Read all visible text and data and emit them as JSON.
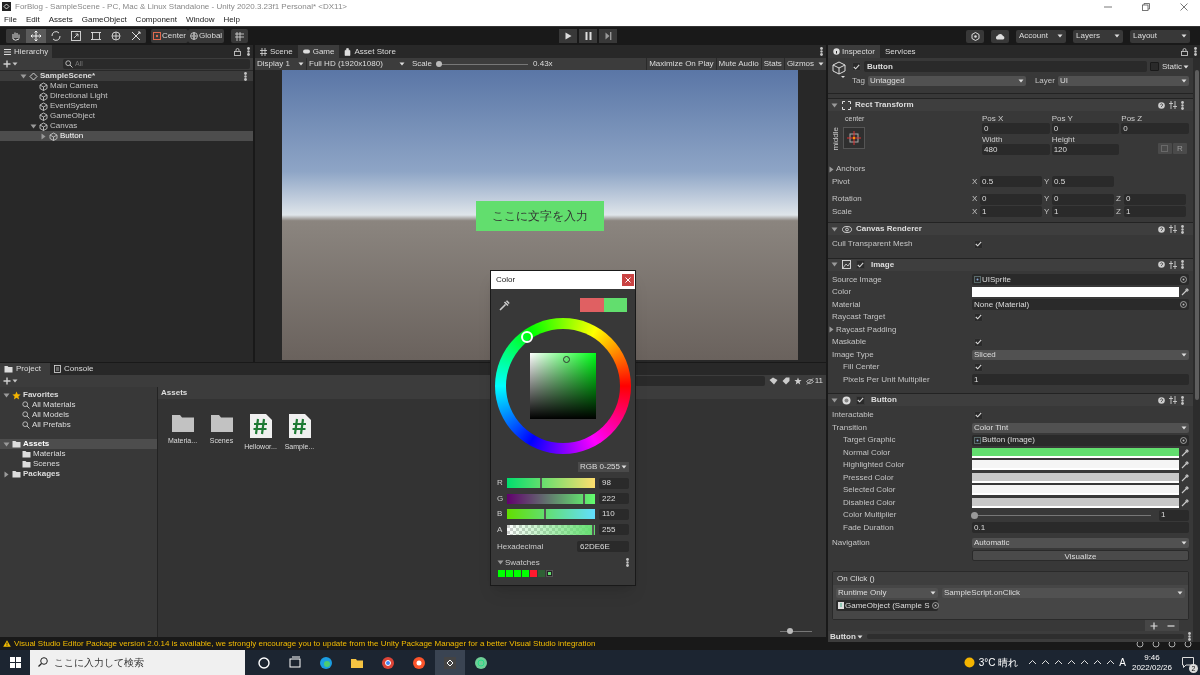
{
  "window": {
    "title": "ForBlog - SampleScene - PC, Mac & Linux Standalone - Unity 2020.3.23f1 Personal* <DX11>"
  },
  "menu": [
    "File",
    "Edit",
    "Assets",
    "GameObject",
    "Component",
    "Window",
    "Help"
  ],
  "toolbar": {
    "tools": [
      {
        "kind": "hand",
        "selected": false
      },
      {
        "kind": "move",
        "selected": true
      },
      {
        "kind": "rotate",
        "selected": false
      },
      {
        "kind": "scale",
        "selected": false
      },
      {
        "kind": "rect",
        "selected": false
      },
      {
        "kind": "transform",
        "selected": false
      },
      {
        "kind": "custom",
        "selected": false
      }
    ],
    "pivot": "Center",
    "space": "Global",
    "account": "Account",
    "layers": "Layers",
    "layout": "Layout"
  },
  "hierarchy": {
    "tab": "Hierarchy",
    "search_placeholder": "All",
    "items": [
      {
        "label": "SampleScene*",
        "kind": "scene",
        "expanded": true,
        "selected": false,
        "children": [
          {
            "label": "Main Camera",
            "kind": "object",
            "selected": false
          },
          {
            "label": "Directional Light",
            "kind": "object",
            "selected": false
          },
          {
            "label": "EventSystem",
            "kind": "object",
            "selected": false
          },
          {
            "label": "GameObject",
            "kind": "object",
            "selected": false
          },
          {
            "label": "Canvas",
            "kind": "object",
            "expanded": true,
            "selected": false,
            "children": [
              {
                "label": "Button",
                "kind": "object",
                "expanded": false,
                "selected": true
              }
            ]
          }
        ]
      }
    ]
  },
  "game": {
    "tabs": [
      {
        "label": "Scene",
        "kind": "scene",
        "selected": false
      },
      {
        "label": "Game",
        "kind": "game",
        "selected": true
      },
      {
        "label": "Asset Store",
        "kind": "store",
        "selected": false
      }
    ],
    "display": "Display 1",
    "resolution": "Full HD (1920x1080)",
    "scale_label": "Scale",
    "scale": {
      "level": 0.02
    },
    "scale_value": "0.43x",
    "buttons": [
      "Maximize On Play",
      "Mute Audio",
      "Stats",
      "Gizmos"
    ],
    "ui_button": "ここに文字を入力"
  },
  "project": {
    "tabs": [
      {
        "label": "Project",
        "kind": "folder",
        "selected": true
      },
      {
        "label": "Console",
        "kind": "console",
        "selected": false
      }
    ],
    "tree": [
      {
        "label": "Favorites",
        "kind": "favorite",
        "expanded": true,
        "selected": false,
        "children": [
          {
            "label": "All Materials",
            "kind": "search",
            "selected": false
          },
          {
            "label": "All Models",
            "kind": "search",
            "selected": false
          },
          {
            "label": "All Prefabs",
            "kind": "search",
            "selected": false
          }
        ]
      },
      {
        "label": "Assets",
        "kind": "folder",
        "expanded": true,
        "selected": true,
        "children": [
          {
            "label": "Materials",
            "kind": "folder",
            "selected": false
          },
          {
            "label": "Scenes",
            "kind": "folder",
            "selected": false
          }
        ]
      },
      {
        "label": "Packages",
        "kind": "folder",
        "expanded": false,
        "selected": false
      }
    ],
    "breadcrumb": "Assets",
    "hidden_count": "11",
    "icon_size": {
      "level": 0.3
    },
    "assets": [
      {
        "label": "Materia...",
        "kind": "folder"
      },
      {
        "label": "Scenes",
        "kind": "folder"
      },
      {
        "label": "Hellowor...",
        "kind": "script"
      },
      {
        "label": "Sample...",
        "kind": "script"
      }
    ]
  },
  "color_picker": {
    "title": "Color",
    "preview": [
      {
        "color": "#e06062"
      },
      {
        "color": "#62de6e"
      }
    ],
    "mode": "RGB 0-255",
    "channels": [
      {
        "label": "R",
        "level": 0.384,
        "value": "98"
      },
      {
        "label": "G",
        "level": 0.871,
        "value": "222"
      },
      {
        "label": "B",
        "level": 0.431,
        "value": "110"
      },
      {
        "label": "A",
        "level": 1,
        "value": "255"
      }
    ],
    "hex_label": "Hexadecimal",
    "hex": "62DE6E",
    "swatches_label": "Swatches",
    "swatches": [
      {
        "color": "#00ff00"
      },
      {
        "color": "#00ff00"
      },
      {
        "color": "#00ff00"
      },
      {
        "color": "#00ff00"
      },
      {
        "color": "#ff1a2e"
      },
      {
        "color": "#2f5f35"
      }
    ]
  },
  "inspector": {
    "tabs": [
      {
        "label": "Inspector",
        "selected": true
      },
      {
        "label": "Services",
        "selected": false
      }
    ],
    "object": {
      "active": true,
      "name": "Button",
      "static_label": "Static",
      "static": false,
      "tag_label": "Tag",
      "tag": "Untagged",
      "layer_label": "Layer",
      "layer": "UI"
    },
    "rect_transform": {
      "title": "Rect Transform",
      "anchor_h": "center",
      "anchor_v": "middle",
      "fields": [
        {
          "label": "Pos X",
          "value": "0"
        },
        {
          "label": "Pos Y",
          "value": "0"
        },
        {
          "label": "Pos Z",
          "value": "0"
        },
        {
          "label": "Width",
          "value": "480"
        },
        {
          "label": "Height",
          "value": "120"
        }
      ],
      "raw_button": "R",
      "rows": [
        {
          "label": "Anchors",
          "kind": "foldout",
          "expanded": false
        },
        {
          "label": "Pivot",
          "kind": "vector",
          "axes": [
            {
              "axis": "X",
              "value": "0.5"
            },
            {
              "axis": "Y",
              "value": "0.5"
            }
          ]
        },
        {
          "label": "Rotation",
          "kind": "vector",
          "axes": [
            {
              "axis": "X",
              "value": "0"
            },
            {
              "axis": "Y",
              "value": "0"
            },
            {
              "axis": "Z",
              "value": "0"
            }
          ]
        },
        {
          "label": "Scale",
          "kind": "vector",
          "axes": [
            {
              "axis": "X",
              "value": "1"
            },
            {
              "axis": "Y",
              "value": "1"
            },
            {
              "axis": "Z",
              "value": "1"
            }
          ]
        }
      ]
    },
    "components": [
      {
        "title": "Canvas Renderer",
        "kind": "renderer",
        "rows": [
          {
            "label": "Cull Transparent Mesh",
            "kind": "check",
            "checked": true
          }
        ]
      },
      {
        "title": "Image",
        "kind": "image",
        "enabled": true,
        "rows": [
          {
            "label": "Source Image",
            "kind": "object",
            "value": "UISprite"
          },
          {
            "label": "Color",
            "kind": "color",
            "color": "#ffffff"
          },
          {
            "label": "Material",
            "kind": "object",
            "value": "None (Material)"
          },
          {
            "label": "Raycast Target",
            "kind": "check",
            "checked": true
          },
          {
            "label": "Raycast Padding",
            "kind": "foldout",
            "expanded": false
          },
          {
            "label": "Maskable",
            "kind": "check",
            "checked": true
          },
          {
            "label": "Image Type",
            "kind": "dropdown",
            "value": "Sliced",
            "children": [
              {
                "label": "Fill Center",
                "kind": "check",
                "checked": true
              },
              {
                "label": "Pixels Per Unit Multiplier",
                "kind": "text",
                "value": "1"
              }
            ]
          }
        ]
      },
      {
        "title": "Button",
        "kind": "button",
        "enabled": true,
        "rows": [
          {
            "label": "Interactable",
            "kind": "check",
            "checked": true
          },
          {
            "label": "Transition",
            "kind": "dropdown",
            "value": "Color Tint",
            "children": [
              {
                "label": "Target Graphic",
                "kind": "object",
                "value": "Button (Image)"
              },
              {
                "label": "Normal Color",
                "kind": "color",
                "color": "#62de6e"
              },
              {
                "label": "Highlighted Color",
                "kind": "color",
                "color": "#f5f5f5"
              },
              {
                "label": "Pressed Color",
                "kind": "color",
                "color": "#c8c8c8"
              },
              {
                "label": "Selected Color",
                "kind": "color",
                "color": "#f5f5f5"
              },
              {
                "label": "Disabled Color",
                "kind": "color",
                "color": "#c8c8c8"
              },
              {
                "label": "Color Multiplier",
                "kind": "slider",
                "level": 0,
                "value": "1"
              },
              {
                "label": "Fade Duration",
                "kind": "text",
                "value": "0.1"
              }
            ]
          },
          {
            "label": "Navigation",
            "kind": "dropdown",
            "value": "Automatic"
          },
          {
            "label": "Visualize",
            "kind": "button"
          }
        ]
      }
    ],
    "on_click": {
      "title": "On Click ()",
      "runtime": "Runtime Only",
      "function": "SampleScript.onClick",
      "target": "GameObject (Sample S"
    },
    "footer": "Button"
  },
  "status": "Visual Studio Editor Package version 2.0.14 is available, we strongly encourage you to update from the Unity Package Manager for a better Visual Studio integration",
  "taskbar": {
    "search_placeholder": "ここに入力して検索",
    "weather": "3°C 晴れ",
    "ime": "A",
    "time": "9:46",
    "date": "2022/02/26",
    "notifications": "2"
  }
}
